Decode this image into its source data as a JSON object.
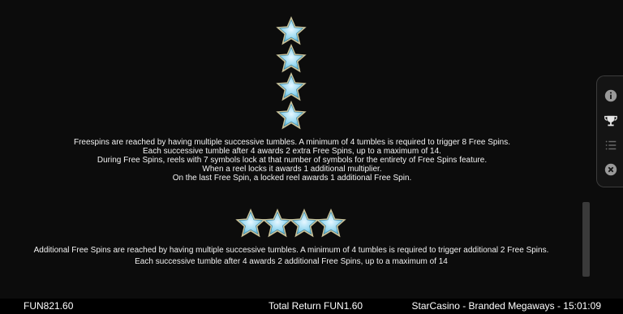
{
  "colors": {
    "background": "#0c0c0c",
    "star_fill": "#8fd4ee",
    "star_outline": "#c9c29a",
    "panel_bg": "#141414",
    "panel_icon": "#9a9a9a",
    "status_bar_bg": "#000000"
  },
  "section1": {
    "stars": [
      "star-icon",
      "star-icon",
      "star-icon",
      "star-icon"
    ],
    "lines": [
      "Freespins are reached by having multiple successive tumbles. A minimum of 4 tumbles is required to trigger 8 Free Spins.",
      "Each successive tumble after 4 awards 2 extra Free Spins, up to a maximum of 14.",
      "During Free Spins, reels with 7 symbols lock at that number of symbols for the entirety of Free Spins feature.",
      "When a reel locks it awards 1 additional multiplier.",
      "On the last Free Spin, a locked reel awards 1 additional Free Spin."
    ]
  },
  "section2": {
    "stars": [
      "star-icon",
      "star-icon",
      "star-icon",
      "star-icon"
    ],
    "lines": [
      "Additional Free Spins are reached by having multiple successive tumbles. A minimum of 4 tumbles is required to trigger additional 2 Free Spins.",
      "Each successive tumble after 4 awards 2 additional Free Spins, up to a maximum of 14"
    ]
  },
  "side_panel": {
    "icons": [
      "info-icon",
      "trophy-icon",
      "list-icon",
      "close-icon"
    ]
  },
  "status_bar": {
    "balance": "FUN821.60",
    "total_return": "Total Return FUN1.60",
    "casino_info": "StarCasino - Branded Megaways - 15:01:09"
  }
}
